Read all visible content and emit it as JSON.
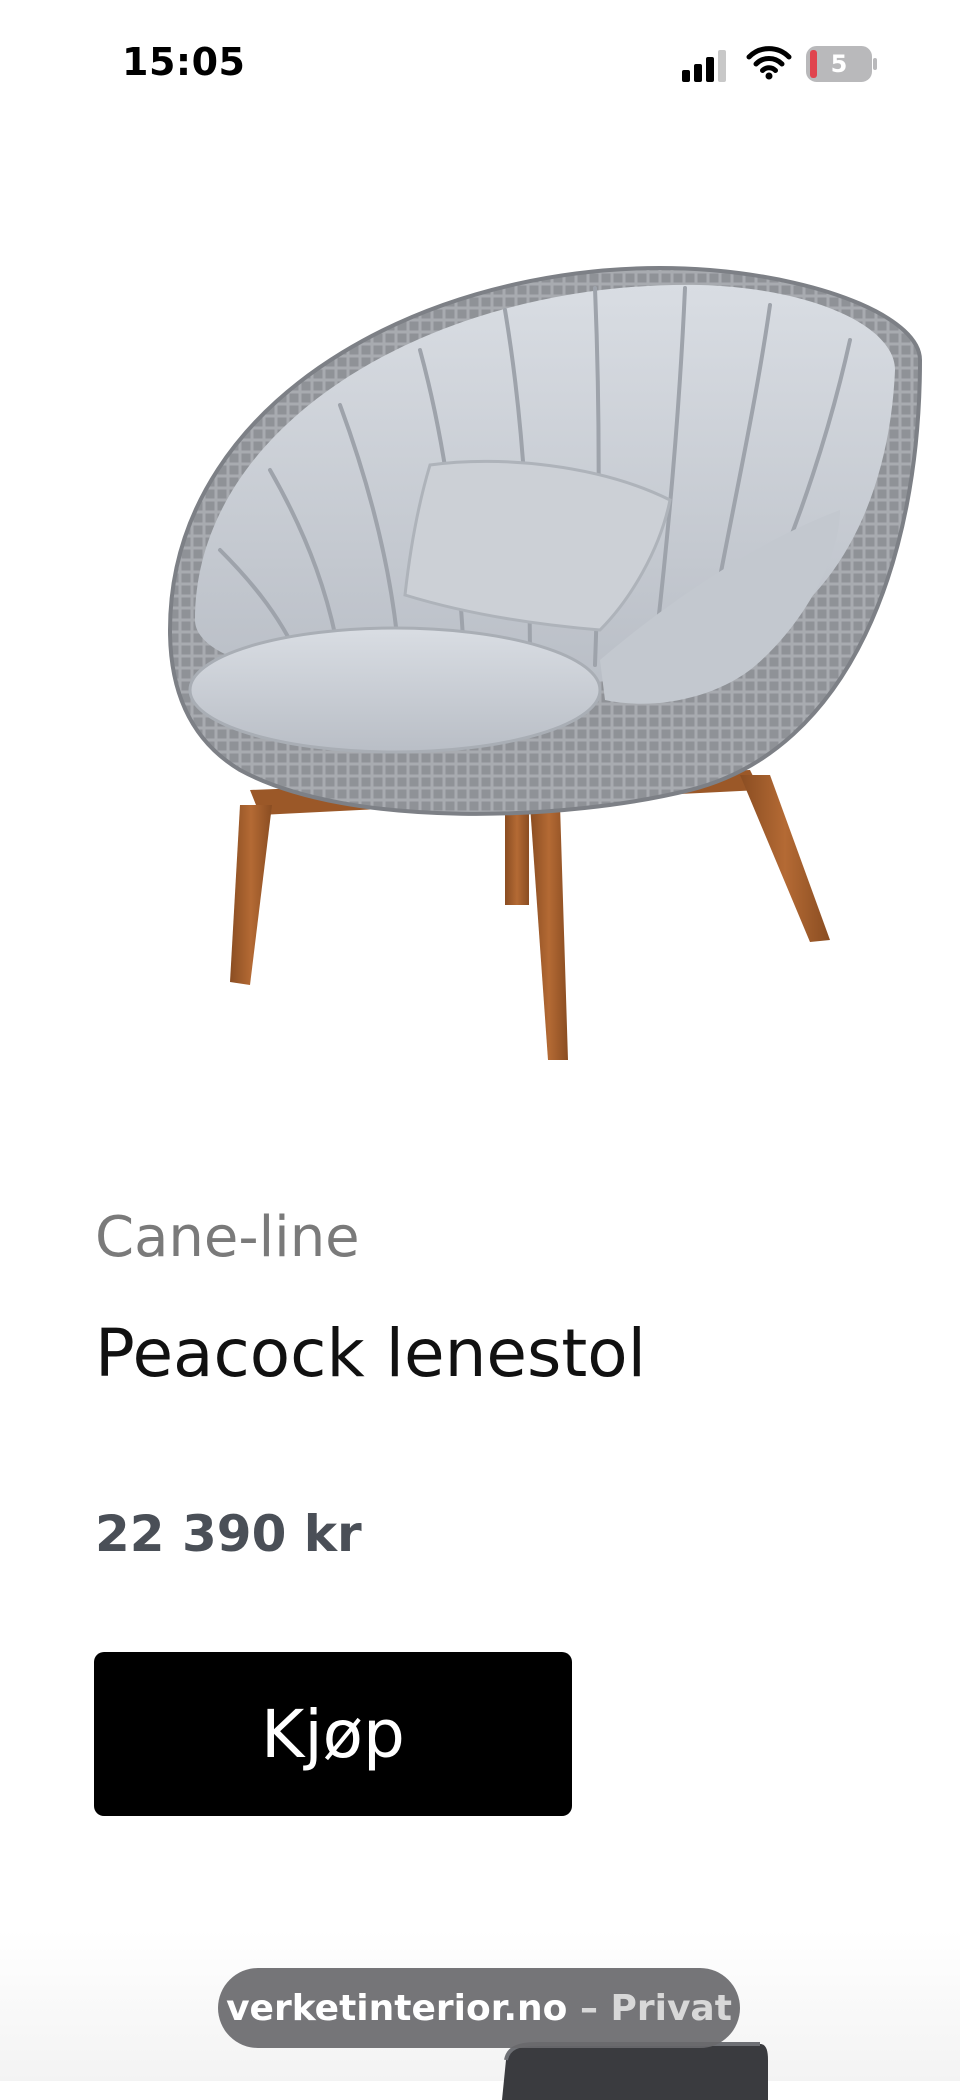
{
  "status_bar": {
    "time": "15:05",
    "battery_level": "5",
    "icons": [
      "signal-icon",
      "wifi-icon",
      "battery-icon"
    ]
  },
  "product": {
    "image": "lounge-chair-image",
    "brand": "Cane-line",
    "title": "Peacock lenestol",
    "price": "22 390 kr",
    "buy_label": "Kjøp"
  },
  "browser_bar": {
    "domain": "verketinterior.no",
    "separator": "–",
    "mode": "Privat"
  },
  "colors": {
    "button_bg": "#000000",
    "brand_text": "#7a7a7a",
    "price_text": "#4a4f57",
    "battery_low": "#e0444e"
  }
}
